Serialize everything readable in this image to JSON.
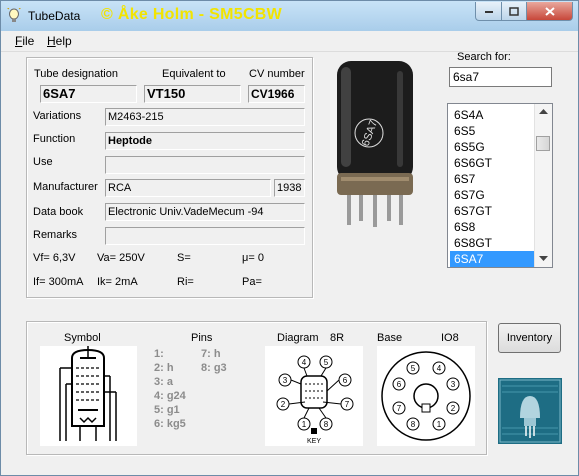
{
  "window": {
    "title": "TubeData",
    "brand": "© Åke Holm - SM5CBW"
  },
  "menu": [
    {
      "label": "File",
      "key": "F",
      "rest": "ile"
    },
    {
      "label": "Help",
      "key": "H",
      "rest": "elp"
    }
  ],
  "fields": {
    "designation_label": "Tube designation",
    "designation": "6SA7",
    "equivalent_label": "Equivalent to",
    "equivalent": "VT150",
    "cv_label": "CV number",
    "cv": "CV1966",
    "variations_label": "Variations",
    "variations": "M2463-215",
    "function_label": "Function",
    "function": "Heptode",
    "use_label": "Use",
    "use": "",
    "manufacturer_label": "Manufacturer",
    "manufacturer": "RCA",
    "year": "1938",
    "databook_label": "Data book",
    "databook": "Electronic Univ.VadeMecum -94",
    "remarks_label": "Remarks",
    "remarks": ""
  },
  "params": {
    "vf": "Vf= 6,3V",
    "va": "Va=  250V",
    "s": "S=",
    "mu": "μ=    0",
    "if": "If= 300mA",
    "ik": "Ik=   2mA",
    "ri": "Ri=",
    "pa": "Pa="
  },
  "search": {
    "label": "Search for:",
    "value": "6sa7"
  },
  "tube_list": {
    "items": [
      "6S4A",
      "6S5",
      "6S5G",
      "6S6GT",
      "6S7",
      "6S7G",
      "6S7GT",
      "6S8",
      "6S8GT",
      "6SA7"
    ],
    "selected": "6SA7"
  },
  "tube_photo_marking": "6SA7",
  "bottom": {
    "symbol_label": "Symbol",
    "pins_label": "Pins",
    "diagram_label": "Diagram",
    "diagram_code": "8R",
    "base_label": "Base",
    "base_code": "IO8",
    "pins": [
      {
        "text": "1:"
      },
      {
        "text": "2: h"
      },
      {
        "text": "3: a"
      },
      {
        "text": "4: g24"
      },
      {
        "text": "5: g1"
      },
      {
        "text": "6: kg5"
      },
      {
        "text": "7: h"
      },
      {
        "text": "8: g3"
      }
    ],
    "diagram_key": "KEY"
  },
  "inventory_button": "Inventory",
  "colors": {
    "brand": "#f2e400",
    "selection": "#3399ff",
    "titlebar": "#a9cdea"
  }
}
